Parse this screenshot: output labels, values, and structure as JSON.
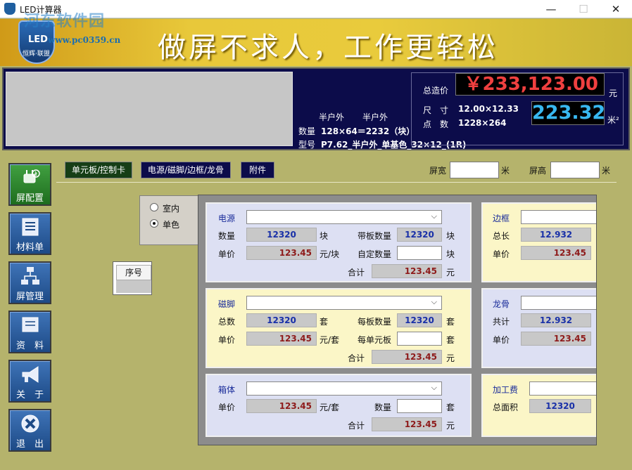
{
  "window": {
    "title": "LED计算器",
    "controls": {
      "minimize": "—",
      "maximize": "☐",
      "close": "✕"
    },
    "watermark": "河东软件园",
    "watermark_url": "www.pc0359.cn"
  },
  "banner": {
    "logo_text": "LED",
    "logo_sub": "恒辉·联盟",
    "slogan": "做屏不求人，工作更轻松"
  },
  "info": {
    "env_col1": "半户外",
    "env_col2": "半户外",
    "qty_label": "数量",
    "qty_value": "128×64＝2232（块）",
    "model_label": "型号",
    "model_value": "P7.62_半户外_单基色_32×12_(1R)",
    "total_label": "总造价",
    "total_value": "￥233,123.00",
    "total_unit": "元",
    "size_label": "尺　寸",
    "size_value": "12.00×12.33",
    "dots_label": "点　数",
    "dots_value": "1228×264",
    "area_value": "223.32",
    "area_unit": "米²"
  },
  "sidebar": {
    "items": [
      {
        "label": "屏配置",
        "icon": "plug-icon",
        "active": true
      },
      {
        "label": "材料单",
        "icon": "list-icon",
        "active": false
      },
      {
        "label": "屏管理",
        "icon": "network-icon",
        "active": false
      },
      {
        "label": "资　料",
        "icon": "document-icon",
        "active": false
      },
      {
        "label": "关　于",
        "icon": "megaphone-icon",
        "active": false
      },
      {
        "label": "退　出",
        "icon": "exit-icon",
        "active": false
      }
    ]
  },
  "tabs": [
    {
      "label": "单元板/控制卡"
    },
    {
      "label": "电源/磁脚/边框/龙骨"
    },
    {
      "label": "附件"
    }
  ],
  "dimensions": {
    "width_label": "屏宽",
    "width_value": "",
    "width_unit": "米",
    "height_label": "屏高",
    "height_value": "",
    "height_unit": "米"
  },
  "options": {
    "indoor": "室内",
    "mono": "单色"
  },
  "seq_table": {
    "header": "序号"
  },
  "power": {
    "title": "电源",
    "qty_label": "数量",
    "qty_value": "12320",
    "qty_unit": "块",
    "boards_label": "带板数量",
    "boards_value": "12320",
    "boards_unit": "块",
    "price_label": "单价",
    "price_value": "123.45",
    "price_unit": "元/块",
    "custom_label": "自定数量",
    "custom_unit": "块",
    "sum_label": "合计",
    "sum_value": "123.45",
    "sum_unit": "元"
  },
  "magnet": {
    "title": "磁脚",
    "total_label": "总数",
    "total_value": "12320",
    "total_unit": "套",
    "per_label": "每板数量",
    "per_value": "12320",
    "per_unit": "套",
    "price_label": "单价",
    "price_value": "123.45",
    "price_unit": "元/套",
    "per_unit_board_label": "每单元板",
    "per_unit_board_unit": "套",
    "sum_label": "合计",
    "sum_value": "123.45",
    "sum_unit": "元"
  },
  "cabinet": {
    "title": "箱体",
    "price_label": "单价",
    "price_value": "123.45",
    "price_unit": "元/套",
    "qty_label": "数量",
    "qty_unit": "套",
    "sum_label": "合计",
    "sum_value": "123.45",
    "sum_unit": "元"
  },
  "frame": {
    "title": "边框",
    "length_label": "总长",
    "length_value": "12.932",
    "price_label": "单价",
    "price_value": "123.45"
  },
  "keel": {
    "title": "龙骨",
    "total_label": "共计",
    "total_value": "12.932",
    "price_label": "单价",
    "price_value": "123.45"
  },
  "labor": {
    "title": "加工费",
    "area_label": "总面积",
    "area_value": "12320"
  }
}
